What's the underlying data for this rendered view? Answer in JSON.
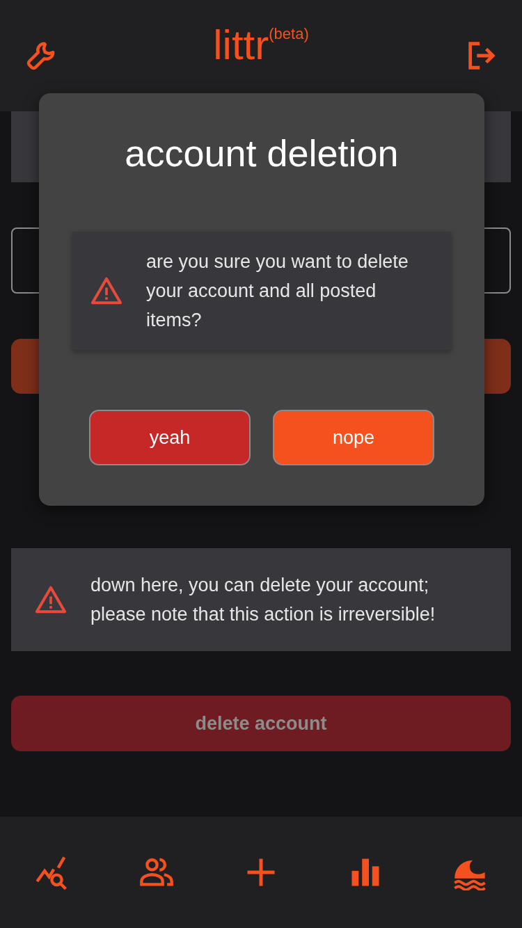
{
  "header": {
    "title": "littr",
    "badge": "(beta)"
  },
  "background": {
    "notice": "down here, you can delete your account; please note that this action is irreversible!",
    "delete_button": {
      "label": "delete account",
      "disabled": true
    }
  },
  "dialog": {
    "title": "account deletion",
    "message": "are you sure you want to delete your account and all posted items?",
    "buttons": [
      {
        "label": "yeah",
        "kind": "confirm"
      },
      {
        "label": "nope",
        "kind": "cancel"
      }
    ]
  }
}
